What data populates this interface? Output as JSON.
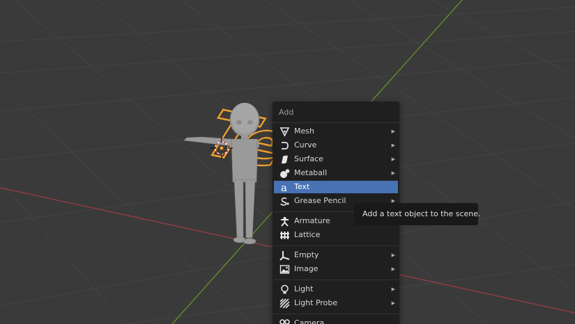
{
  "scene": {
    "text_object_glyphs": "Text"
  },
  "menu": {
    "title": "Add",
    "items": [
      {
        "label": "Mesh",
        "icon": "mesh-icon"
      },
      {
        "label": "Curve",
        "icon": "curve-icon"
      },
      {
        "label": "Surface",
        "icon": "surface-icon"
      },
      {
        "label": "Metaball",
        "icon": "metaball-icon"
      },
      {
        "label": "Text",
        "icon": "text-icon"
      },
      {
        "label": "Grease Pencil",
        "icon": "grease-pencil-icon"
      },
      {
        "label": "Armature",
        "icon": "armature-icon"
      },
      {
        "label": "Lattice",
        "icon": "lattice-icon"
      },
      {
        "label": "Empty",
        "icon": "empty-icon"
      },
      {
        "label": "Image",
        "icon": "image-icon"
      },
      {
        "label": "Light",
        "icon": "light-icon"
      },
      {
        "label": "Light Probe",
        "icon": "light-probe-icon"
      },
      {
        "label": "Camera",
        "icon": "camera-icon"
      }
    ],
    "submenu_arrow": "▶"
  },
  "tooltip": {
    "text": "Add a text object to the scene."
  },
  "colors": {
    "viewport_background": "#3a3a3a",
    "menu_background": "#1f1f1f",
    "highlight": "#4772b3",
    "selection_outline": "#f0a030",
    "x_axis": "#a23c45",
    "y_axis": "#6a9a2a"
  }
}
